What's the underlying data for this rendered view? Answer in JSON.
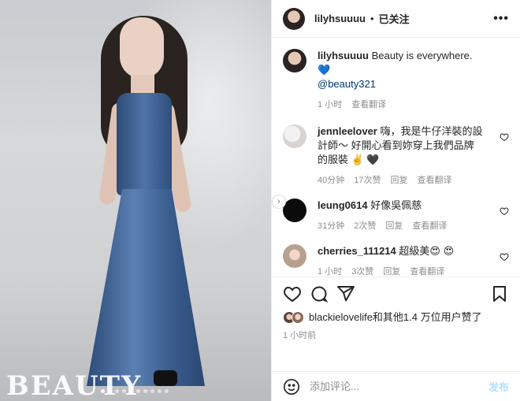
{
  "post": {
    "username": "lilyhsuuuu",
    "separator": "•",
    "follow_status": "已关注",
    "more_icon": "more-horizontal-icon",
    "brand_watermark": "BEAUTY",
    "carousel": {
      "total": 10,
      "active": 1
    }
  },
  "caption": {
    "username": "lilyhsuuuu",
    "text": "Beauty is everywhere. 💙",
    "mention": "@beauty321",
    "time": "1 小时",
    "translate": "查看翻译"
  },
  "comments": [
    {
      "username": "jennleelover",
      "text": "嗨，我是牛仔洋裝的設計師～ 好開心看到妳穿上我們品牌的服裝 ✌️ 🖤",
      "time": "40分钟",
      "likes": "17次赞",
      "reply": "回复",
      "translate": "查看翻译"
    },
    {
      "username": "leung0614",
      "text": "好像吳佩慈",
      "time": "31分钟",
      "likes": "2次赞",
      "reply": "回复",
      "translate": "查看翻译"
    },
    {
      "username": "cherries_111214",
      "text": "超級美😍 😍",
      "time": "1 小时",
      "likes": "3次赞",
      "reply": "回复",
      "translate": "查看翻译"
    }
  ],
  "likes_summary": "blackielovelife和其他1.4 万位用户赞了",
  "post_time": "1 小时前",
  "add_comment": {
    "placeholder": "添加评论...",
    "post_label": "发布"
  },
  "colors": {
    "link": "#00376b",
    "muted": "#8e8e8e",
    "post_disabled": "#b2dffc"
  }
}
